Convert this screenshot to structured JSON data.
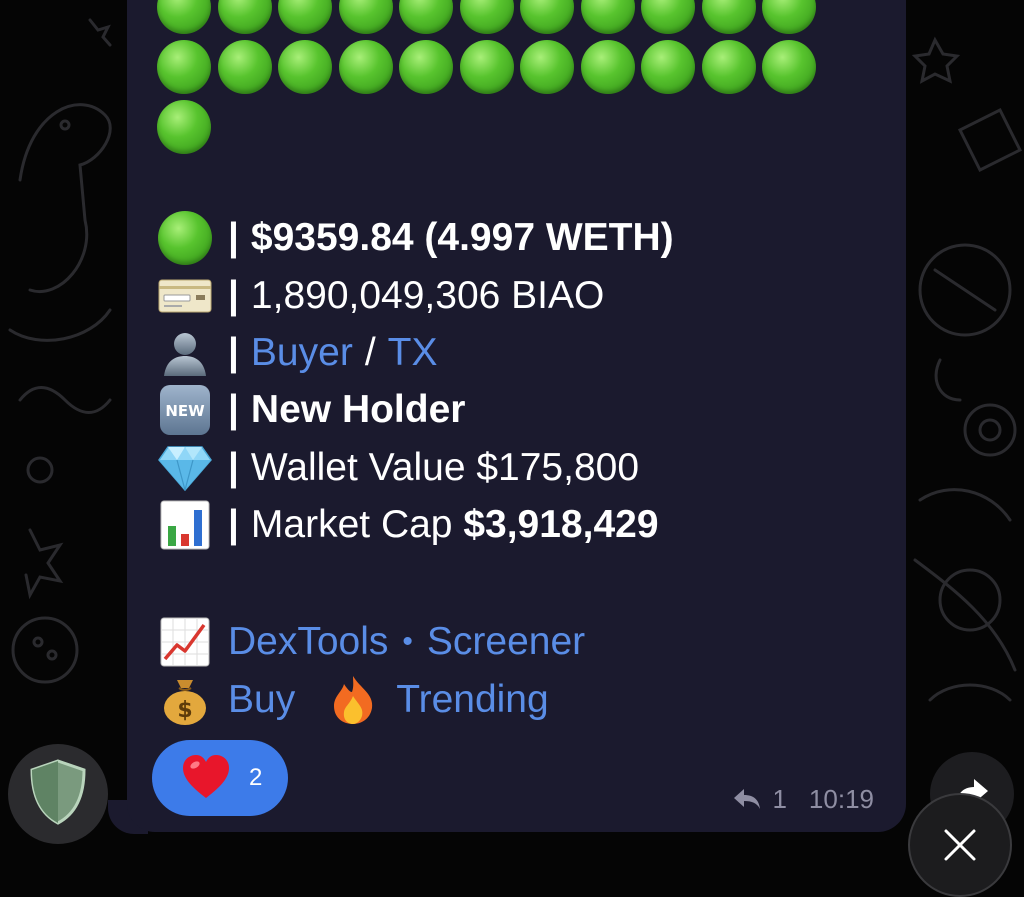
{
  "message": {
    "green_dots_rows": [
      11,
      11,
      1
    ],
    "amount": "$9359.84 (4.997 WETH)",
    "separator": "|",
    "tokens": "1,890,049,306 BIAO",
    "buyer_link": "Buyer",
    "slash": "/",
    "tx_link": "TX",
    "new_holder": "New Holder",
    "wallet_value_label": "Wallet Value $175,800",
    "market_cap_label": "Market Cap ",
    "market_cap_value": "$3,918,429",
    "dextools_link": "DexTools",
    "dot_sep": "•",
    "screener_link": "Screener",
    "buy_link": "Buy",
    "trending_link": "Trending",
    "icons": [
      "green-circle-icon",
      "credit-card-icon",
      "person-silhouette-icon",
      "new-button-icon",
      "gem-icon",
      "bar-chart-icon",
      "chart-increasing-icon",
      "money-bag-icon",
      "fire-icon"
    ]
  },
  "reaction": {
    "emoji": "heart-icon",
    "count": "2"
  },
  "meta": {
    "replies": "1",
    "time": "10:19"
  },
  "colors": {
    "bubble": "#1b1a2e",
    "link": "#5a8de6",
    "reaction": "#3d7be9",
    "green": "#58c42e"
  }
}
